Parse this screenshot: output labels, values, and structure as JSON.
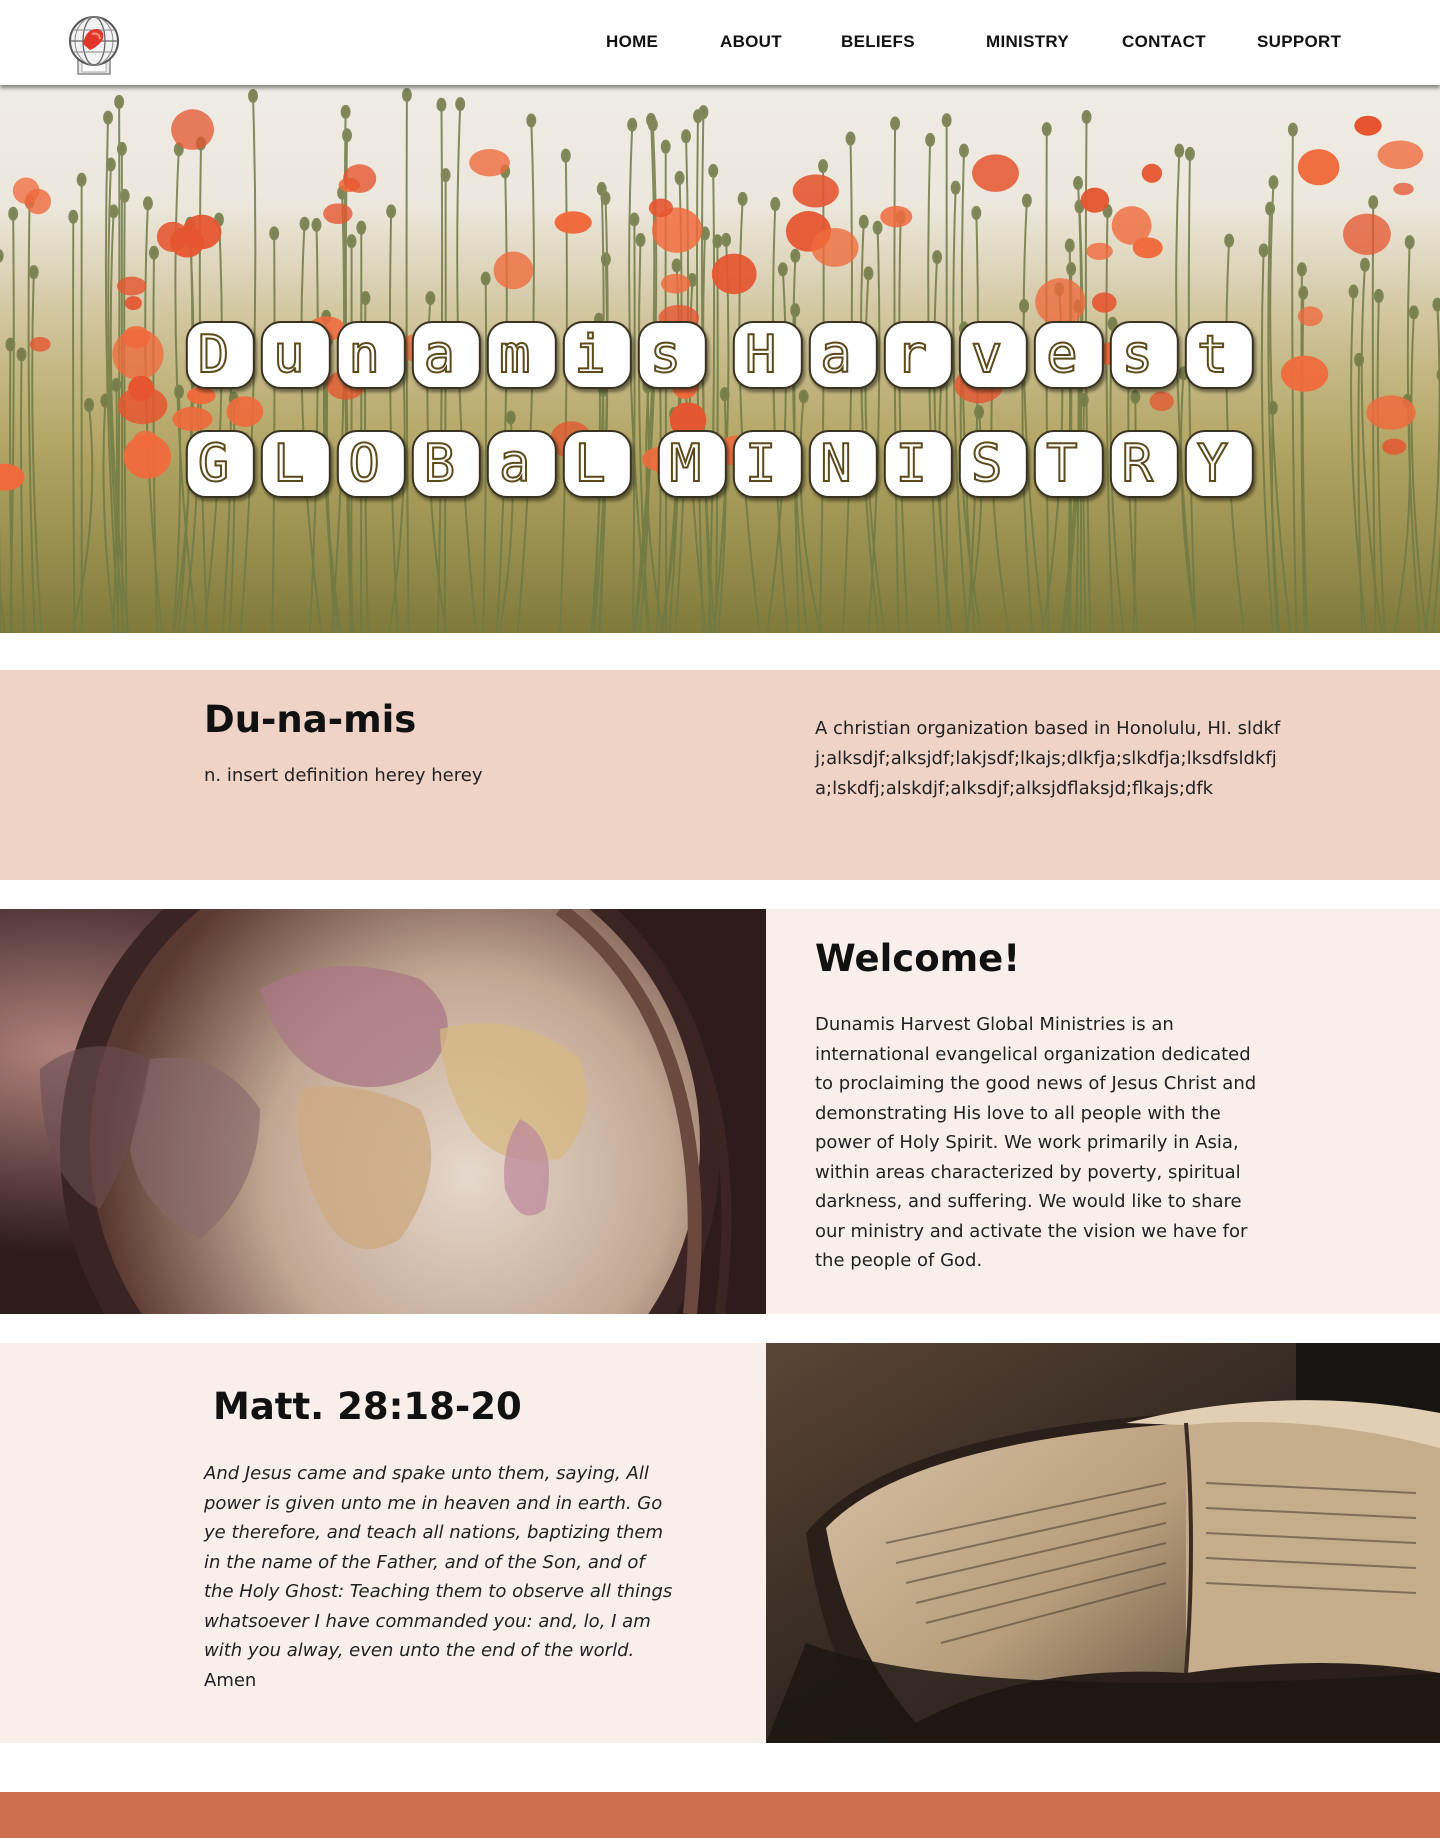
{
  "header": {
    "logo_alt": "Dunamis Harvest logo",
    "nav": [
      {
        "label": "HOME"
      },
      {
        "label": "ABOUT"
      },
      {
        "label": "BELIEFS"
      },
      {
        "label": "MINISTRY"
      },
      {
        "label": "CONTACT"
      },
      {
        "label": "SUPPORT"
      }
    ]
  },
  "hero": {
    "title_line1": [
      "D",
      "u",
      "n",
      "a",
      "m",
      "i",
      "s",
      " ",
      "H",
      "a",
      "r",
      "v",
      "e",
      "s",
      "t"
    ],
    "title_line2": [
      "G",
      "L",
      "O",
      "B",
      "a",
      "L",
      " ",
      "M",
      "I",
      "N",
      "I",
      "S",
      "T",
      "R",
      "Y"
    ]
  },
  "definition": {
    "term": "Du-na-mis",
    "text": "n. insert definition herey herey",
    "description": "A christian organization based in Honolulu, HI. sldkfj;alksdjf;alksjdf;lakjsdf;lkajs;dlkfja;slkdfja;lksdfsldkfja;lskdfj;alskdjf;alksdjf;alksjdflaksjd;flkajs;dfk"
  },
  "welcome": {
    "title": "Welcome!",
    "body": "Dunamis Harvest Global Ministries is an international evangelical organization dedicated to proclaiming the good news of Jesus Christ and demonstrating His love to all people with the power of Holy Spirit.   We work primarily in Asia, within areas characterized by poverty, spiritual darkness, and suffering.  We would like to share our ministry and activate the vision we have for the people of God."
  },
  "scripture": {
    "reference": "Matt. 28:18-20",
    "verse": "And Jesus came and spake unto them, saying, All power is given unto me in heaven and in earth. Go ye therefore, and teach all nations, baptizing them in the name of the Father, and of the Son, and of the Holy Ghost: Teaching them to observe all things whatsoever I have commanded you: and, lo, I am with you alway, even unto the end of the world.",
    "closing": "  Amen"
  },
  "colors": {
    "definition_band": "#efd3c7",
    "panel": "#f8efea",
    "footer": "#cd6f4d"
  },
  "icons": {
    "logo": "globe-cross-logo-icon"
  }
}
